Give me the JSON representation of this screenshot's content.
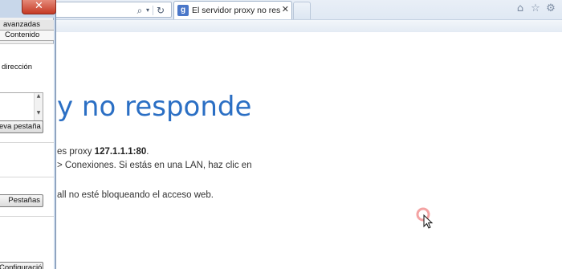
{
  "browser": {
    "tab": {
      "favicon": "g",
      "title": "El servidor proxy no responde",
      "close": "✕"
    },
    "icons": {
      "search": "search-icon",
      "refresh": "refresh-icon",
      "home": "home-icon",
      "favorites": "star-icon",
      "tools": "gear-icon"
    }
  },
  "page": {
    "title_visible": "y no responde",
    "line1_prefix": "es proxy ",
    "proxy_address": "127.1.1.1:80",
    "line1_suffix": ".",
    "line2": "> Conexiones. Si estás en una LAN, haz clic en",
    "line3": "all no esté bloqueando el acceso web."
  },
  "dialog": {
    "close_glyph": "✕",
    "tab_row1": "avanzadas",
    "tab_row2": "Contenido",
    "label_direccion": "dirección",
    "btn_nueva_pestana": "eva pestaña",
    "btn_pestanas": "Pestañas",
    "btn_configuracion": "Configuración"
  }
}
